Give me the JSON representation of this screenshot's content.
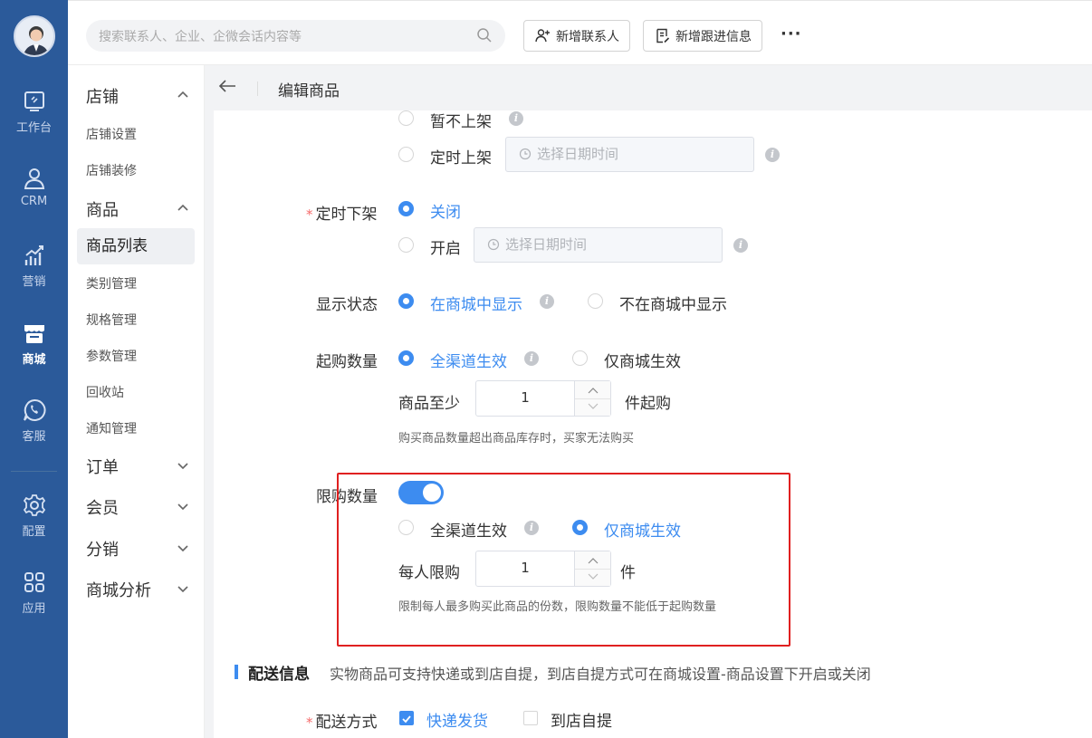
{
  "rail": {
    "items": [
      {
        "label": "工作台",
        "icon": "workbench-icon"
      },
      {
        "label": "CRM",
        "icon": "person-icon"
      },
      {
        "label": "营销",
        "icon": "chart-growth-icon"
      },
      {
        "label": "商城",
        "icon": "store-icon",
        "active": true
      },
      {
        "label": "客服",
        "icon": "chat-phone-icon"
      },
      {
        "label": "配置",
        "icon": "gear-icon"
      },
      {
        "label": "应用",
        "icon": "apps-grid-icon"
      }
    ]
  },
  "topbar": {
    "search_placeholder": "搜索联系人、企业、企微会话内容等",
    "add_contact": "新增联系人",
    "add_followup": "新增跟进信息",
    "more": "···"
  },
  "sidebar": {
    "group_store": "店铺",
    "store_settings": "店铺设置",
    "store_decoration": "店铺装修",
    "group_goods": "商品",
    "goods_list": "商品列表",
    "category": "类别管理",
    "spec": "规格管理",
    "params": "参数管理",
    "recycle": "回收站",
    "notify": "通知管理",
    "group_order": "订单",
    "group_member": "会员",
    "group_distribution": "分销",
    "group_analysis": "商城分析"
  },
  "header": {
    "title": "编辑商品"
  },
  "form": {
    "listing_none": "暂不上架",
    "listing_timed": "定时上架",
    "date_placeholder": "选择日期时间",
    "timed_off_label": "定时下架",
    "timed_off_close": "关闭",
    "timed_off_open": "开启",
    "display_label": "显示状态",
    "display_show": "在商城中显示",
    "display_hide": "不在商城中显示",
    "min_label": "起购数量",
    "min_all": "全渠道生效",
    "min_mall": "仅商城生效",
    "min_prefix": "商品至少",
    "min_value": "1",
    "min_suffix": "件起购",
    "min_hint": "购买商品数量超出商品库存时，买家无法购买",
    "limit_label": "限购数量",
    "limit_all": "全渠道生效",
    "limit_mall": "仅商城生效",
    "limit_prefix": "每人限购",
    "limit_value": "1",
    "limit_suffix": "件",
    "limit_hint": "限制每人最多购买此商品的份数，限购数量不能低于起购数量",
    "ship_title": "配送信息",
    "ship_desc": "实物商品可支持快递或到店自提，到店自提方式可在商城设置-商品设置下开启或关闭",
    "ship_label": "配送方式",
    "ship_express": "快递发货",
    "ship_pickup": "到店自提"
  },
  "colors": {
    "accent": "#3d8cf0",
    "rail": "#2b5a9a",
    "highlight_box": "#e02020"
  }
}
